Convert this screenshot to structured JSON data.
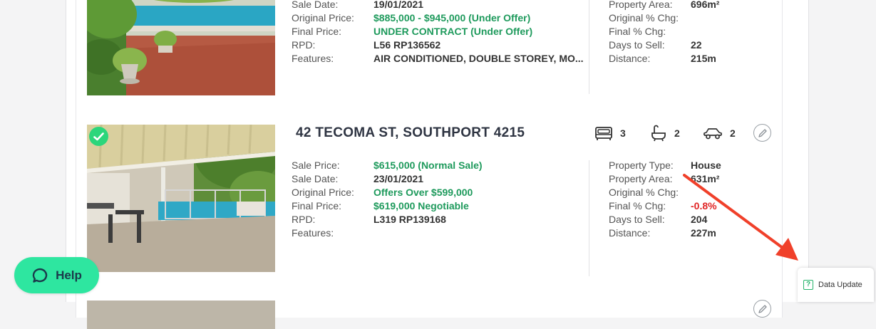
{
  "listings": [
    {
      "address": "",
      "details_left": [
        {
          "label": "Sale Date:",
          "value": "19/01/2021",
          "tone": "dark"
        },
        {
          "label": "Original Price:",
          "value": "$885,000 - $945,000 (Under Offer)",
          "tone": "green"
        },
        {
          "label": "Final Price:",
          "value": "UNDER CONTRACT (Under Offer)",
          "tone": "green"
        },
        {
          "label": "RPD:",
          "value": "L56 RP136562",
          "tone": "dark"
        },
        {
          "label": "Features:",
          "value": "AIR CONDITIONED, DOUBLE STOREY, MO...",
          "tone": "dark"
        }
      ],
      "details_right": [
        {
          "label": "Property Area:",
          "value": "696m²",
          "tone": "dark"
        },
        {
          "label": "Original % Chg:",
          "value": "",
          "tone": "dark"
        },
        {
          "label": "Final % Chg:",
          "value": "",
          "tone": "dark"
        },
        {
          "label": "Days to Sell:",
          "value": "22",
          "tone": "dark"
        },
        {
          "label": "Distance:",
          "value": "215m",
          "tone": "dark"
        }
      ]
    },
    {
      "address": "42 TECOMA ST, SOUTHPORT 4215",
      "selected": true,
      "beds": "3",
      "baths": "2",
      "cars": "2",
      "details_left": [
        {
          "label": "Sale Price:",
          "value": "$615,000 (Normal Sale)",
          "tone": "green"
        },
        {
          "label": "Sale Date:",
          "value": "23/01/2021",
          "tone": "dark"
        },
        {
          "label": "Original Price:",
          "value": "Offers Over $599,000",
          "tone": "green"
        },
        {
          "label": "Final Price:",
          "value": "$619,000 Negotiable",
          "tone": "green"
        },
        {
          "label": "RPD:",
          "value": "L319 RP139168",
          "tone": "dark"
        },
        {
          "label": "Features:",
          "value": "",
          "tone": "dark"
        }
      ],
      "details_right": [
        {
          "label": "Property Type:",
          "value": "House",
          "tone": "dark"
        },
        {
          "label": "Property Area:",
          "value": "631m²",
          "tone": "dark"
        },
        {
          "label": "Original % Chg:",
          "value": "",
          "tone": "dark"
        },
        {
          "label": "Final % Chg:",
          "value": "-0.8%",
          "tone": "red"
        },
        {
          "label": "Days to Sell:",
          "value": "204",
          "tone": "dark"
        },
        {
          "label": "Distance:",
          "value": "227m",
          "tone": "dark"
        }
      ]
    }
  ],
  "help_button": {
    "label": "Help",
    "color": "#2ee6a0"
  },
  "data_update": {
    "label": "Data Update",
    "icon": "question-square-icon"
  },
  "annotation": {
    "type": "red-arrow",
    "color": "#f0402a"
  },
  "colors": {
    "green": "#1e9a5c",
    "red": "#e02424",
    "address": "#2e3442"
  }
}
